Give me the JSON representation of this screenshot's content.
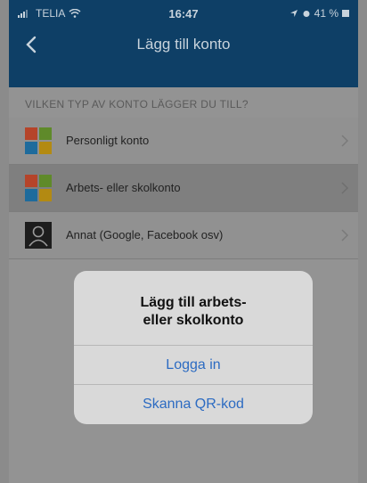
{
  "status_bar": {
    "carrier": "TELIA",
    "time": "16:47",
    "battery": "41 %"
  },
  "nav": {
    "title": "Lägg till konto",
    "back_icon": "chevron-left-icon"
  },
  "section": {
    "header": "VILKEN TYP AV KONTO LÄGGER DU TILL?"
  },
  "accounts": [
    {
      "label": "Personligt konto",
      "icon": "microsoft-icon"
    },
    {
      "label": "Arbets- eller skolkonto",
      "icon": "microsoft-icon"
    },
    {
      "label": "Annat (Google, Facebook osv)",
      "icon": "person-icon"
    }
  ],
  "dialog": {
    "title_line1": "Lägg till arbets-",
    "title_line2": "eller skolkonto",
    "button1": "Logga in",
    "button2": "Skanna QR-kod"
  },
  "colors": {
    "nav_bar": "#0e3f66",
    "action": "#2c6bc2"
  }
}
